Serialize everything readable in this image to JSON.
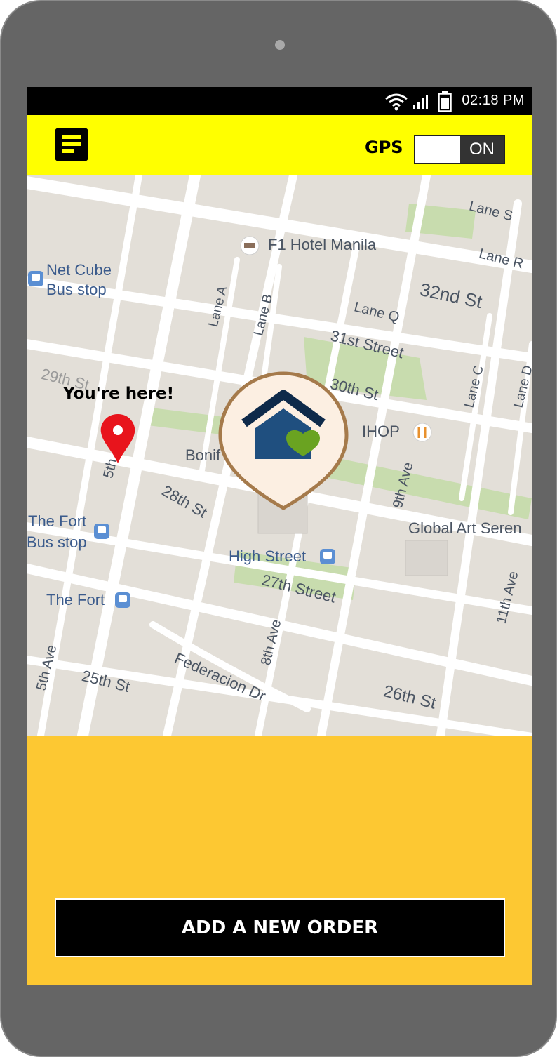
{
  "status_bar": {
    "time": "02:18 PM"
  },
  "app_bar": {
    "gps_label": "GPS",
    "gps_state": "ON"
  },
  "map": {
    "you_are_here_label": "You're here!",
    "labels": {
      "f1_hotel": "F1 Hotel Manila",
      "net_cube_1": "Net Cube",
      "net_cube_2": "Bus stop",
      "lane_s": "Lane S",
      "lane_r": "Lane R",
      "street_32nd": "32nd St",
      "lane_q": "Lane Q",
      "street_31st": "31st Street",
      "lane_a": "Lane A",
      "lane_b": "Lane B",
      "lane_c": "Lane C",
      "lane_d": "Lane D",
      "street_30th": "30th St",
      "street_29th": "29th St",
      "ihop": "IHOP",
      "bonifacio": "Bonif",
      "ave_9th": "9th Ave",
      "ave_5th_top": "5th",
      "street_28th": "28th St",
      "global_art": "Global Art Seren",
      "fort_bus_1": "The Fort",
      "fort_bus_2": "Bus stop",
      "high_street": "High Street",
      "street_27th": "27th Street",
      "the_fort": "The Fort",
      "ave_11th": "11th Ave",
      "ave_8th": "8th Ave",
      "ave_5th": "5th Ave",
      "street_25th": "25th St",
      "federacion": "Federacion Dr",
      "street_26th": "26th St"
    }
  },
  "footer": {
    "add_order_label": "ADD A NEW ORDER"
  },
  "colors": {
    "appbar": "#ffff00",
    "panel": "#fdc832",
    "pin": "#e8141c",
    "house": "#1f4f7f",
    "heart": "#6aa321",
    "marker_ring": "#a57a4b"
  },
  "icons": [
    "menu-icon",
    "wifi-icon",
    "signal-icon",
    "battery-icon",
    "location-pin-icon",
    "home-heart-icon",
    "hotel-icon",
    "bus-stop-icon",
    "restaurant-icon"
  ]
}
